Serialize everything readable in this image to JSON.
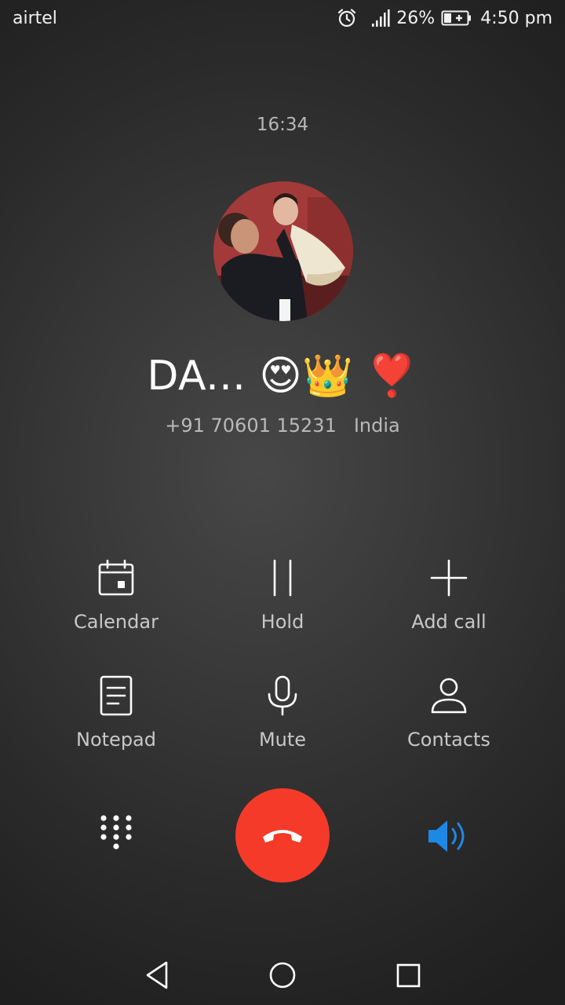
{
  "status_bar": {
    "carrier": "airtel",
    "battery": "26%",
    "time": "4:50 pm",
    "icons": [
      "alarm-icon",
      "signal-icon",
      "battery-charging-icon"
    ]
  },
  "call": {
    "timer": "16:34",
    "caller_name": "DA... 😍👑 ❣️",
    "number": "+91 70601 15231",
    "location": "India"
  },
  "actions": [
    {
      "label": "Calendar",
      "icon": "calendar-icon"
    },
    {
      "label": "Hold",
      "icon": "hold-icon"
    },
    {
      "label": "Add call",
      "icon": "plus-icon"
    },
    {
      "label": "Notepad",
      "icon": "notepad-icon"
    },
    {
      "label": "Mute",
      "icon": "microphone-icon"
    },
    {
      "label": "Contacts",
      "icon": "contact-icon"
    }
  ],
  "controls": {
    "dialpad_icon": "dialpad-icon",
    "end_call_icon": "end-call-icon",
    "speaker_icon": "speaker-icon",
    "speaker_active_color": "#1e88e5",
    "end_call_color": "#f53a2a"
  },
  "nav_bar": [
    "back-icon",
    "home-icon",
    "recents-icon"
  ]
}
